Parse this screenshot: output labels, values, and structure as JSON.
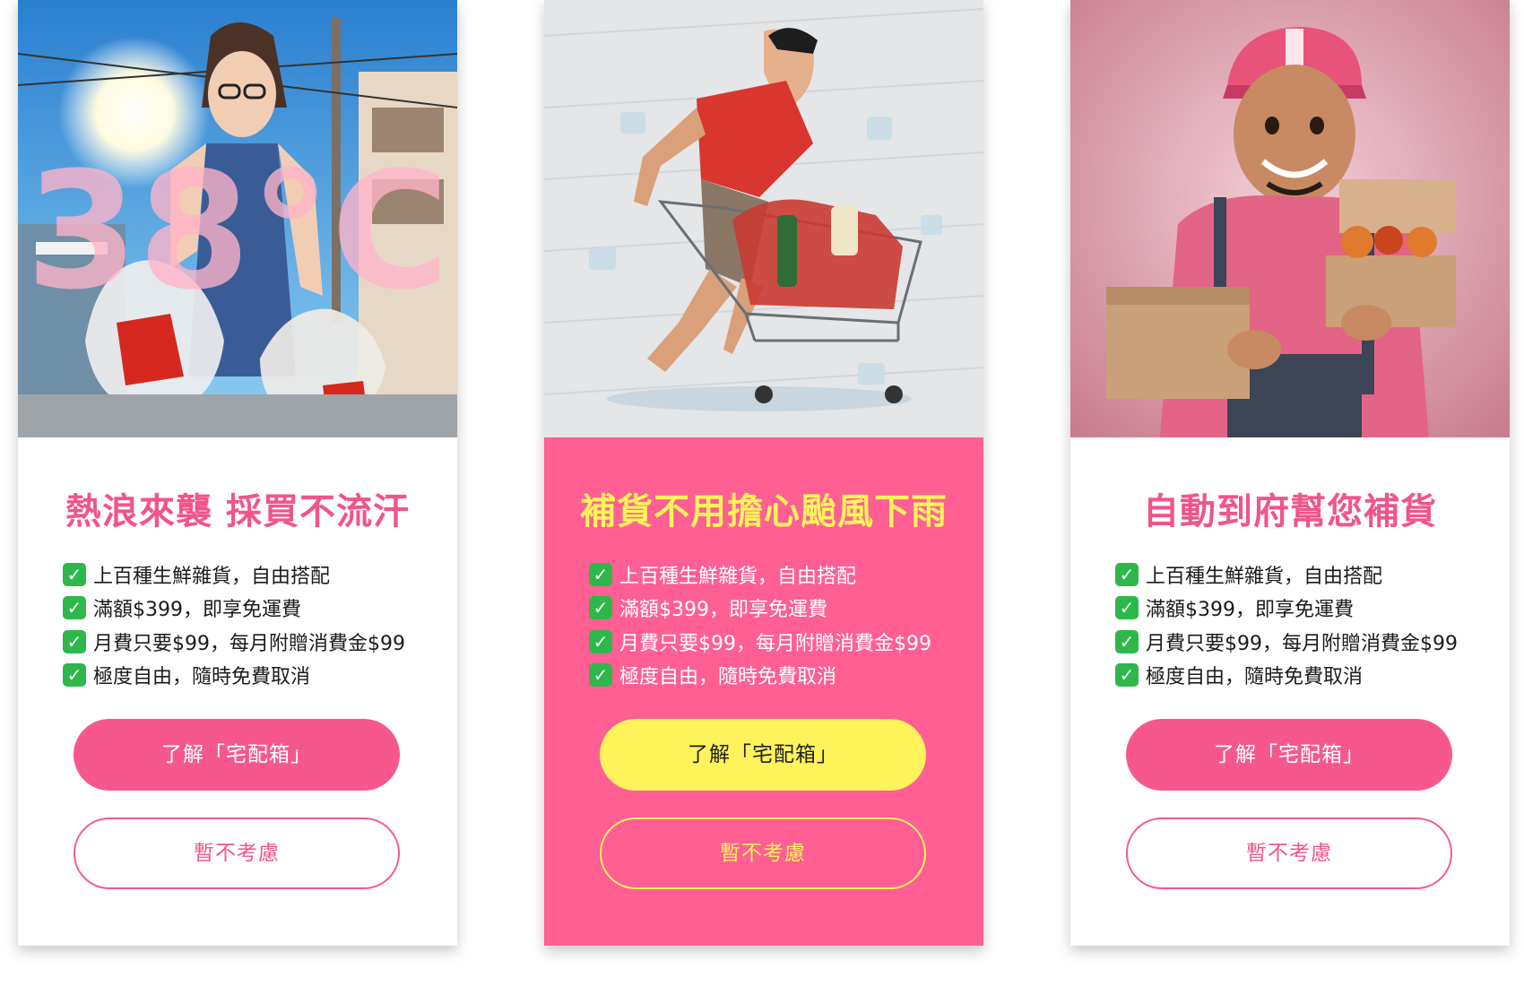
{
  "cards": [
    {
      "image_overlay_text": "38°C",
      "title": "熱浪來襲 採買不流汗",
      "features": [
        "上百種生鮮雜貨，自由搭配",
        "滿額$399，即享免運費",
        "月費只要$99，每月附贈消費金$99",
        "極度自由，隨時免費取消"
      ],
      "primary_button": "了解「宅配箱」",
      "secondary_button": "暫不考慮"
    },
    {
      "title": "補貨不用擔心颱風下雨",
      "features": [
        "上百種生鮮雜貨，自由搭配",
        "滿額$399，即享免運費",
        "月費只要$99，每月附贈消費金$99",
        "極度自由，隨時免費取消"
      ],
      "primary_button": "了解「宅配箱」",
      "secondary_button": "暫不考慮"
    },
    {
      "title": "自動到府幫您補貨",
      "features": [
        "上百種生鮮雜貨，自由搭配",
        "滿額$399，即享免運費",
        "月費只要$99，每月附贈消費金$99",
        "極度自由，隨時免費取消"
      ],
      "primary_button": "了解「宅配箱」",
      "secondary_button": "暫不考慮"
    }
  ],
  "colors": {
    "pink": "#f6588d",
    "highlight_card": "#ff5f93",
    "yellow": "#fff35c",
    "check_green": "#2eb84b"
  },
  "icons": {
    "feature_check": "check-mark-icon"
  }
}
